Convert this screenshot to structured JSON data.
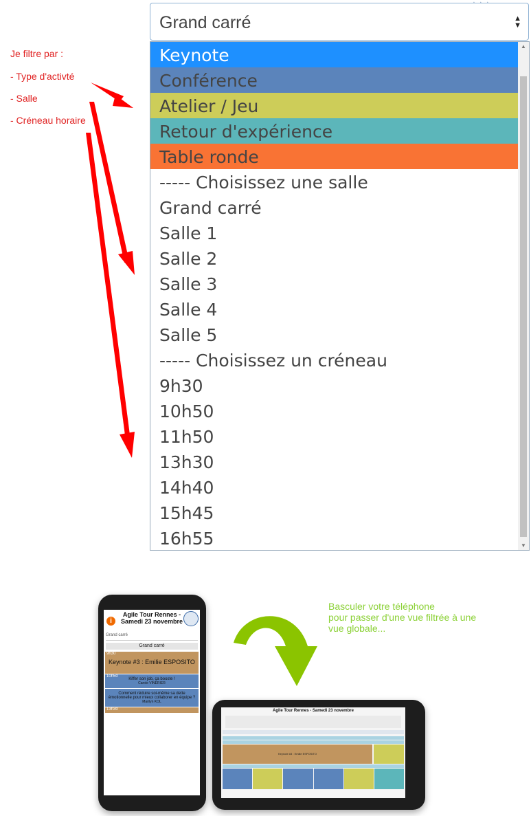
{
  "select": {
    "current_value": "Grand carré",
    "options": [
      {
        "label": "Keynote",
        "bg": "#1e90ff",
        "color": "#ffffff"
      },
      {
        "label": "Conférence",
        "bg": "#5b84bb",
        "color": "#444444"
      },
      {
        "label": "Atelier / Jeu",
        "bg": "#cdcd59",
        "color": "#444444"
      },
      {
        "label": "Retour d'expérience",
        "bg": "#5cb6ba",
        "color": "#444444"
      },
      {
        "label": "Table ronde",
        "bg": "#f97334",
        "color": "#444444"
      },
      {
        "label": "----- Choisissez une salle",
        "bg": "",
        "color": ""
      },
      {
        "label": "Grand carré",
        "bg": "",
        "color": ""
      },
      {
        "label": "Salle 1",
        "bg": "",
        "color": ""
      },
      {
        "label": "Salle 2",
        "bg": "",
        "color": ""
      },
      {
        "label": "Salle 3",
        "bg": "",
        "color": ""
      },
      {
        "label": "Salle 4",
        "bg": "",
        "color": ""
      },
      {
        "label": "Salle 5",
        "bg": "",
        "color": ""
      },
      {
        "label": "----- Choisissez un créneau",
        "bg": "",
        "color": ""
      },
      {
        "label": "9h30",
        "bg": "",
        "color": ""
      },
      {
        "label": "10h50",
        "bg": "",
        "color": ""
      },
      {
        "label": "11h50",
        "bg": "",
        "color": ""
      },
      {
        "label": "13h30",
        "bg": "",
        "color": ""
      },
      {
        "label": "14h40",
        "bg": "",
        "color": ""
      },
      {
        "label": "15h45",
        "bg": "",
        "color": ""
      },
      {
        "label": "16h55",
        "bg": "",
        "color": ""
      }
    ]
  },
  "annotation": {
    "title": "Je filtre par :",
    "items": [
      "- Type d'activté",
      "- Salle",
      "- Créneau horaire"
    ],
    "color": "#e02020"
  },
  "illustration": {
    "hint_lines": [
      "Basculer votre téléphone",
      "pour passer d'une vue filtrée à une",
      "vue globale..."
    ],
    "hint_color": "#8bd136",
    "portrait": {
      "title": "Agile Tour Rennes - Samedi 23 novembre",
      "select_value": "Grand carré",
      "room": "Grand carré",
      "cards": [
        {
          "time": "9h30",
          "title": "Keynote #3 : Emilie ESPOSITO",
          "speaker": "",
          "bg": "#c1955f"
        },
        {
          "time": "10h50",
          "title": "Kiffer son job, ça booste !",
          "speaker": "Carole VINERIER",
          "bg": "#5b84bb"
        },
        {
          "time": "",
          "title": "Comment réduire soi-même sa dette émotionnelle pour mieux collaborer en équipe ?",
          "speaker": "Marilyn KOL",
          "bg": "#5b84bb"
        },
        {
          "time": "13h30",
          "title": "",
          "speaker": "",
          "bg": "#c1955f"
        }
      ]
    },
    "landscape": {
      "title": "Agile Tour Rennes - Samedi 23 novembre",
      "keynote": "Keynote #3 : Emilie ESPOSITO"
    }
  }
}
